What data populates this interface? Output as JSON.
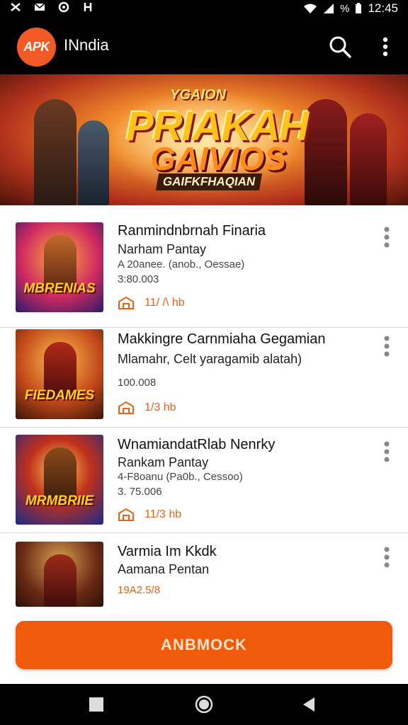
{
  "status_bar": {
    "battery_label": "%",
    "time": "12:45"
  },
  "app_bar": {
    "logo_text": "APK",
    "title": "INndia"
  },
  "banner": {
    "kicker": "YGAION",
    "title_line1": "PRIAKAH",
    "title_line2": "GAIVIOS",
    "subtitle": "GAIFKFHAQIAN"
  },
  "apps": [
    {
      "thumb_caption": "MBRENIAS",
      "title": "Ranmindnbrnah Finaria",
      "developer": "Narham Pantay",
      "meta": "A 20anee. (anob., Oessae)",
      "size": "3:80.003",
      "downloads": "11/ /\\ hb"
    },
    {
      "thumb_caption": "FIEDAMES",
      "title": "Makkingre Carnmiaha Gegamian",
      "developer": "Mlamahr, Celt yaragamib alatah)",
      "size": "100.008",
      "downloads": "1/3 hb"
    },
    {
      "thumb_caption": "MRMBRIIE",
      "title": "WnamiandatRlab Nenrky",
      "developer": "Rankam Pantay",
      "meta": "4-F8oanu (Pa0b., Cessoo)",
      "size": "3. 75.006",
      "downloads": "11/3 hb"
    },
    {
      "thumb_caption": "",
      "title": "Varmia Im Kkdk",
      "developer": "Aamana Pentan",
      "price": "19A2.5/8"
    }
  ],
  "action_button": {
    "label": "ANBMOCK"
  },
  "colors": {
    "accent": "#f15a24",
    "bar": "#000000",
    "divider": "#dcdcdc"
  },
  "icons": [
    "search-icon",
    "more-vert-icon",
    "store-icon",
    "square-icon",
    "circle-icon",
    "back-icon"
  ]
}
